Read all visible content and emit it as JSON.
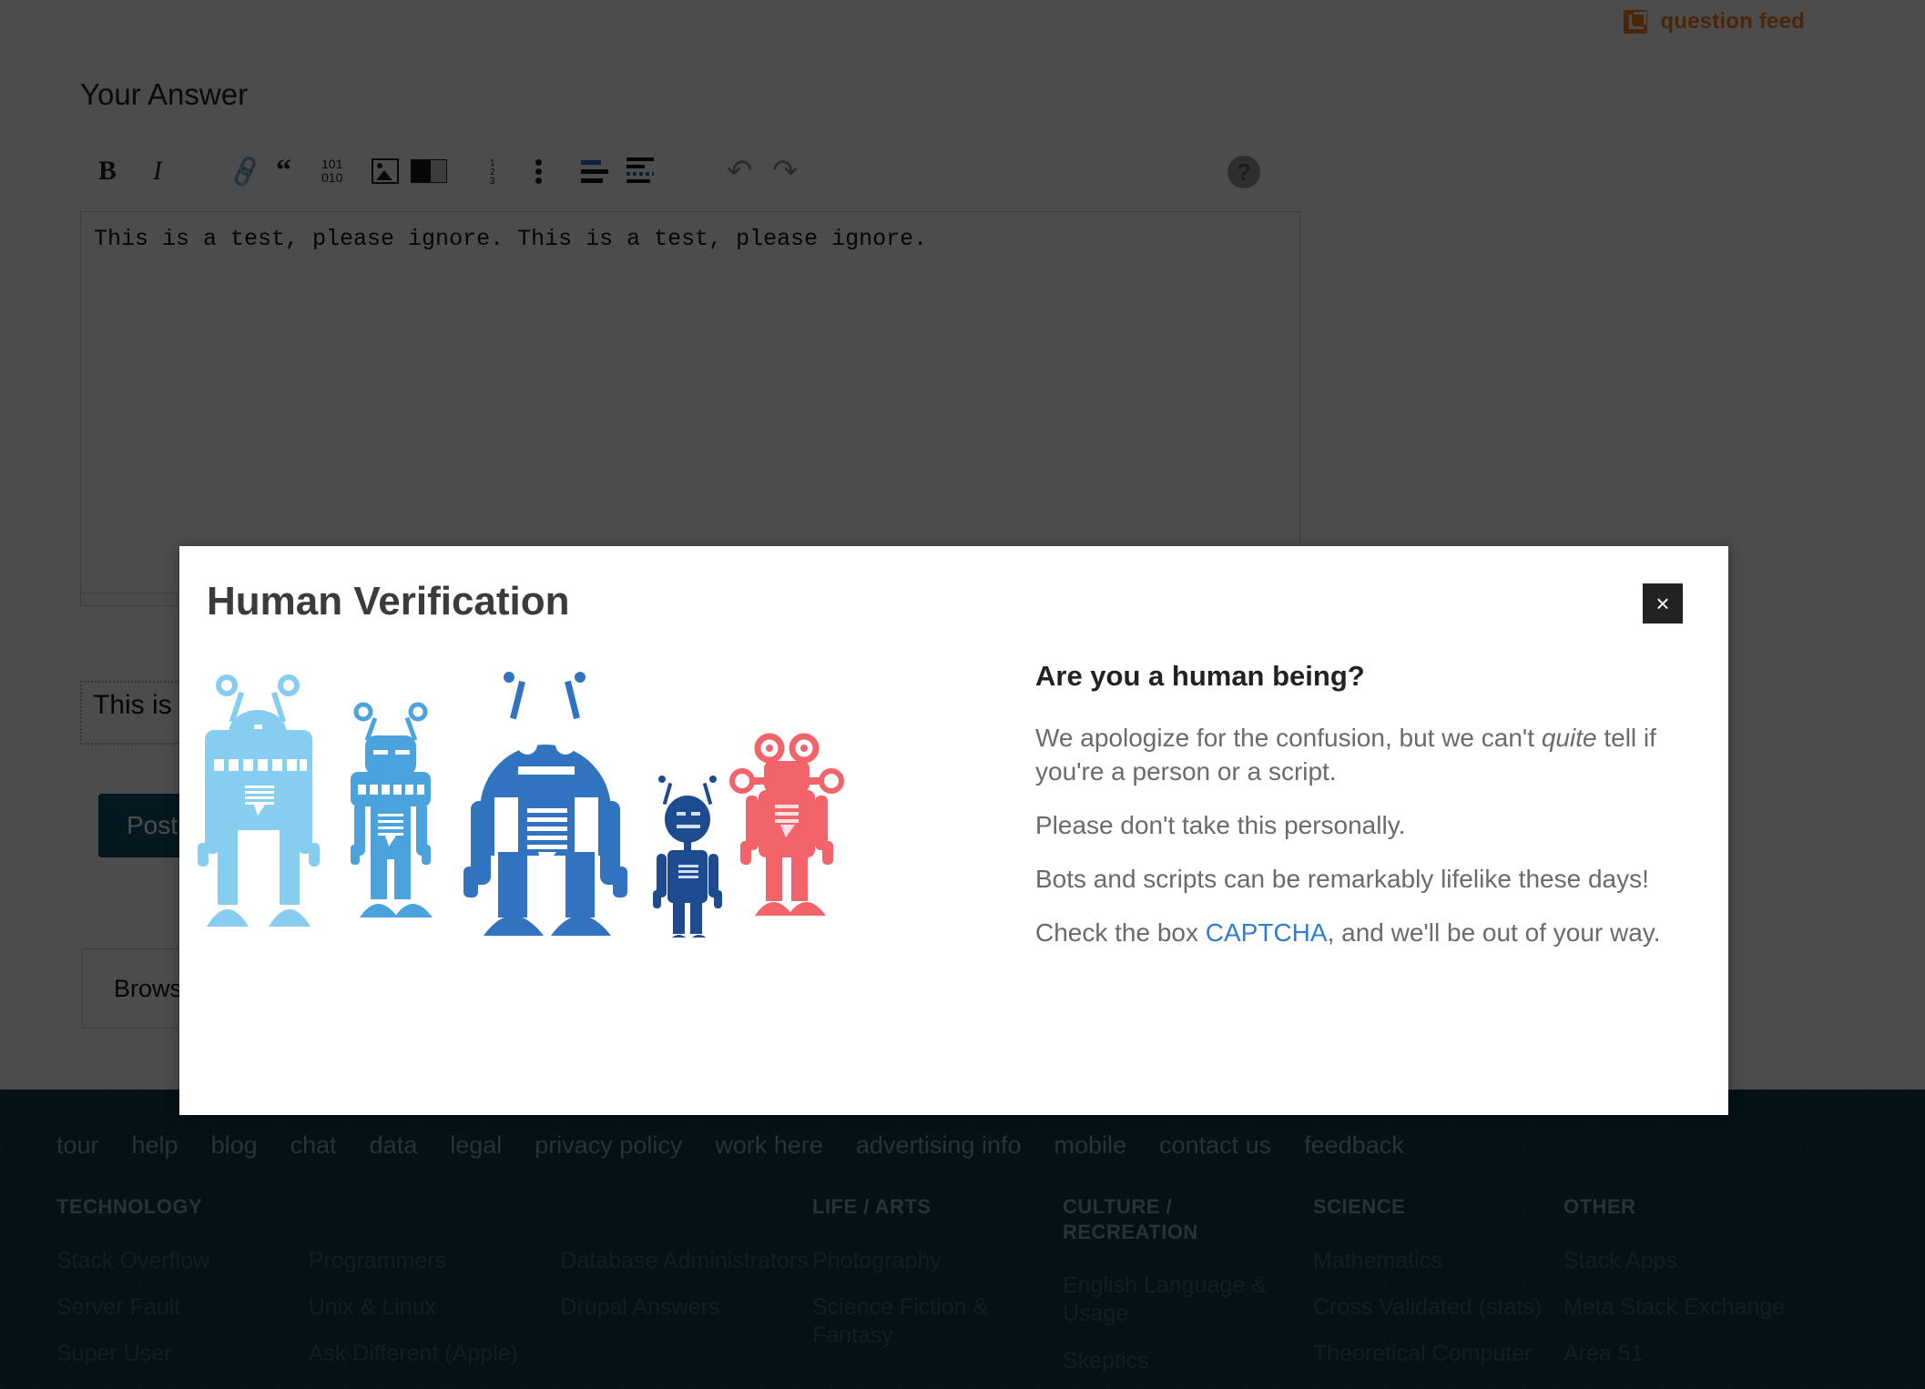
{
  "page": {
    "feed_link": {
      "label": "question feed",
      "icon": "rss-icon",
      "color": "#f38121"
    },
    "answer_heading": "Your Answer",
    "editor": {
      "toolbar": [
        {
          "name": "bold",
          "glyph": "B"
        },
        {
          "name": "italic",
          "glyph": "I"
        },
        {
          "name": "hyperlink",
          "glyph": "🔗"
        },
        {
          "name": "blockquote",
          "glyph": "“"
        },
        {
          "name": "code-sample",
          "glyph_top": "101",
          "glyph_bottom": "010"
        },
        {
          "name": "image",
          "glyph": "image"
        },
        {
          "name": "horizontal-rule",
          "glyph": "hr"
        },
        {
          "name": "numbered-list",
          "glyph": "ol"
        },
        {
          "name": "bulleted-list",
          "glyph": "ul"
        },
        {
          "name": "heading",
          "glyph": "heading"
        },
        {
          "name": "paragraph",
          "glyph": "paragraph"
        },
        {
          "name": "undo",
          "glyph": "↶"
        },
        {
          "name": "redo",
          "glyph": "↷"
        },
        {
          "name": "help",
          "glyph": "?"
        }
      ],
      "textarea_value": "This is a test, please ignore. This is a test, please ignore.",
      "textarea_placeholder": ""
    },
    "preview_text": "This is a test, please ignore. This is a test, please ignore.",
    "post_button": "Post Your Answer",
    "browse_label": "Browse…"
  },
  "modal": {
    "title": "Human Verification",
    "close_label": "×",
    "heading": "Are you a human being?",
    "paragraphs": [
      {
        "before": "We apologize for the confusion, but we can't ",
        "em": "quite",
        "after": " tell if you're a person or a script."
      },
      {
        "before": "Please don't take this personally.",
        "em": "",
        "after": ""
      },
      {
        "before": "Bots and scripts can be remarkably lifelike these days!",
        "em": "",
        "after": ""
      }
    ],
    "captcha_line": {
      "before": "Check the box ",
      "link": "CAPTCHA",
      "after": ", and we'll be out of your way."
    },
    "robot_colors": [
      "#86cdf0",
      "#4ba3dd",
      "#3273bf",
      "#1e4b8f",
      "#f2636a"
    ]
  },
  "footer": {
    "nav": [
      "tour",
      "help",
      "blog",
      "chat",
      "data",
      "legal",
      "privacy policy",
      "work here",
      "advertising info",
      "mobile",
      "contact us",
      "feedback"
    ],
    "columns": [
      {
        "title": "TECHNOLOGY",
        "subcolumns": [
          [
            "Stack Overflow",
            "Server Fault",
            "Super User"
          ],
          [
            "Programmers",
            "Unix & Linux",
            "Ask Different (Apple)"
          ],
          [
            "Database Administrators",
            "Drupal Answers"
          ]
        ]
      },
      {
        "title": "LIFE / ARTS",
        "subcolumns": [
          [
            "Photography",
            "Science Fiction & Fantasy"
          ]
        ]
      },
      {
        "title": "CULTURE / RECREATION",
        "subcolumns": [
          [
            "English Language & Usage",
            "Skeptics"
          ]
        ]
      },
      {
        "title": "SCIENCE",
        "subcolumns": [
          [
            "Mathematics",
            "Cross Validated (stats)",
            "Theoretical Computer"
          ]
        ]
      },
      {
        "title": "OTHER",
        "subcolumns": [
          [
            "Stack Apps",
            "Meta Stack Exchange",
            "Area 51"
          ]
        ]
      }
    ]
  }
}
